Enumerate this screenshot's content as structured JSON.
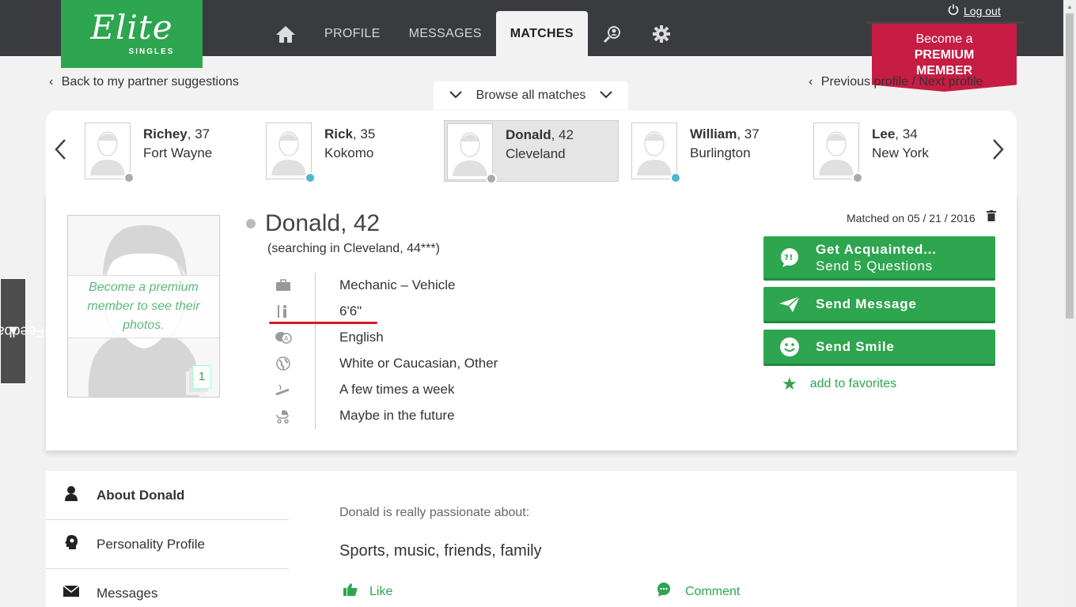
{
  "brand": {
    "name": "Elite",
    "sub": "SINGLES"
  },
  "nav": {
    "home_icon": "home-icon",
    "items": [
      {
        "label": "PROFILE"
      },
      {
        "label": "MESSAGES"
      },
      {
        "label": "MATCHES",
        "active": true
      }
    ],
    "search_icon": "search-user-icon",
    "settings_icon": "gear-icon"
  },
  "logout": "Log out",
  "premium": {
    "line1": "Become a",
    "line2": "PREMIUM",
    "line3": "MEMBER"
  },
  "back_link": "Back to my partner suggestions",
  "prevnext": "Previous profile / Next profile",
  "browse": "Browse all matches",
  "matches": [
    {
      "name": "Richey",
      "age": ", 37",
      "city": "Fort Wayne",
      "status": "#aaaaaa"
    },
    {
      "name": "Rick",
      "age": ", 35",
      "city": "Kokomo",
      "status": "#4fb6d0"
    },
    {
      "name": "Donald",
      "age": ", 42",
      "city": "Cleveland",
      "status": "#aaaaaa",
      "selected": true
    },
    {
      "name": "William",
      "age": ", 37",
      "city": "Burlington",
      "status": "#4fb6d0"
    },
    {
      "name": "Lee",
      "age": ", 34",
      "city": "New York",
      "status": "#aaaaaa"
    }
  ],
  "profile": {
    "name": "Donald, 42",
    "searching": "(searching in Cleveland, 44***)",
    "photo_note": "Become a premium member to see their photos.",
    "photo_count": "1",
    "matched_on": "Matched on 05 / 21 / 2016",
    "details": [
      {
        "icon": "briefcase-icon",
        "value": "Mechanic – Vehicle"
      },
      {
        "icon": "height-icon",
        "value": "6'6\""
      },
      {
        "icon": "language-icon",
        "value": "English"
      },
      {
        "icon": "globe-icon",
        "value": "White or Caucasian, Other"
      },
      {
        "icon": "cigarette-icon",
        "value": "A few times a week"
      },
      {
        "icon": "stroller-icon",
        "value": "Maybe in the future"
      }
    ]
  },
  "actions": {
    "acquaint_title": "Get Acquainted...",
    "acquaint_sub": "Send 5 Questions",
    "send_message": "Send Message",
    "send_smile": "Send Smile",
    "favorites": "add to favorites"
  },
  "sidebar": [
    {
      "label": "About Donald",
      "icon": "person-icon",
      "active": true
    },
    {
      "label": "Personality Profile",
      "icon": "head-icon"
    },
    {
      "label": "Messages",
      "icon": "envelope-icon"
    }
  ],
  "about": {
    "passion_label": "Donald is really passionate about:",
    "passion": "Sports, music, friends, family",
    "like": "Like",
    "comment": "Comment"
  },
  "feedback": "Feedback",
  "colors": {
    "brand_green": "#2ea54f",
    "premium_red": "#c71c43",
    "topbar": "#3a3b3f",
    "underline_red": "#d21b26"
  }
}
